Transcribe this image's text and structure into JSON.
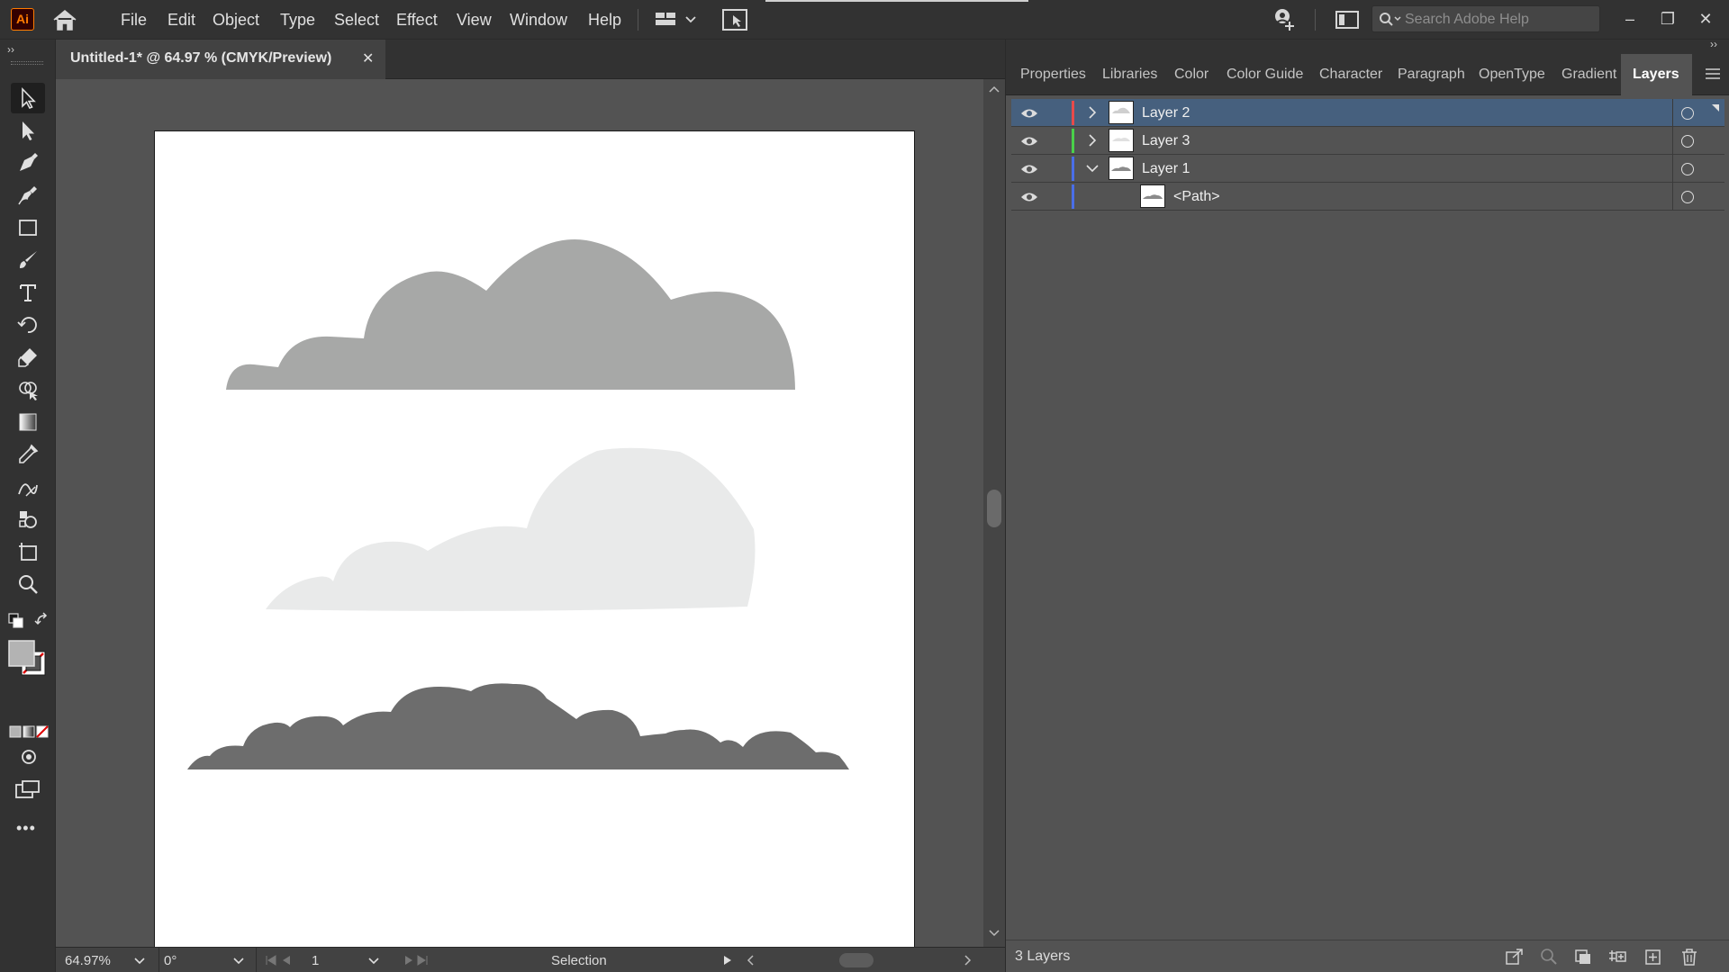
{
  "app": {
    "logo_text": "Ai"
  },
  "menu": [
    {
      "id": "file",
      "label": "File"
    },
    {
      "id": "edit",
      "label": "Edit"
    },
    {
      "id": "object",
      "label": "Object"
    },
    {
      "id": "type",
      "label": "Type"
    },
    {
      "id": "select",
      "label": "Select"
    },
    {
      "id": "effect",
      "label": "Effect"
    },
    {
      "id": "view",
      "label": "View"
    },
    {
      "id": "window",
      "label": "Window"
    },
    {
      "id": "help",
      "label": "Help"
    }
  ],
  "search": {
    "placeholder": "Search Adobe Help"
  },
  "window_controls": {
    "minimize": "–",
    "restore": "❐",
    "close": "✕"
  },
  "document": {
    "tab_title": "Untitled-1* @ 64.97 % (CMYK/Preview)",
    "close_glyph": "✕"
  },
  "toolbar": {
    "tools": [
      {
        "name": "selection-tool-icon",
        "active": true
      },
      {
        "name": "direct-selection-tool-icon"
      },
      {
        "name": "pen-tool-icon"
      },
      {
        "name": "curvature-tool-icon"
      },
      {
        "name": "rectangle-tool-icon"
      },
      {
        "name": "paintbrush-tool-icon"
      },
      {
        "name": "type-tool-icon"
      },
      {
        "name": "rotate-tool-icon"
      },
      {
        "name": "eraser-tool-icon"
      },
      {
        "name": "shape-builder-tool-icon"
      },
      {
        "name": "gradient-tool-icon"
      },
      {
        "name": "eyedropper-tool-icon"
      },
      {
        "name": "blend-tool-icon"
      },
      {
        "name": "symbol-sprayer-tool-icon"
      },
      {
        "name": "artboard-tool-icon"
      },
      {
        "name": "zoom-tool-icon"
      }
    ],
    "fill_color": "#b3b3b3"
  },
  "artwork": {
    "cloud_top_color": "#a7a8a7",
    "cloud_middle_color": "#e9eaea",
    "cloud_bottom_color": "#6d6d6d"
  },
  "statusbar": {
    "zoom": "64.97%",
    "rotation": "0°",
    "artboard_number": "1",
    "current_tool": "Selection"
  },
  "panel_tabs": [
    {
      "id": "properties",
      "label": "Properties"
    },
    {
      "id": "libraries",
      "label": "Libraries"
    },
    {
      "id": "color",
      "label": "Color"
    },
    {
      "id": "color-guide",
      "label": "Color Guide"
    },
    {
      "id": "character",
      "label": "Character"
    },
    {
      "id": "paragraph",
      "label": "Paragraph"
    },
    {
      "id": "opentype",
      "label": "OpenType"
    },
    {
      "id": "gradient",
      "label": "Gradient"
    },
    {
      "id": "layers",
      "label": "Layers",
      "active": true
    }
  ],
  "layers": [
    {
      "name": "Layer 2",
      "color": "#e84a4a",
      "expanded": false,
      "selected": true
    },
    {
      "name": "Layer 3",
      "color": "#4ad14a",
      "expanded": false
    },
    {
      "name": "Layer 1",
      "color": "#4a6ee8",
      "expanded": true
    },
    {
      "name": "<Path>",
      "color": "#4a6ee8",
      "child": true
    }
  ],
  "layers_footer": {
    "count_label": "3 Layers"
  }
}
